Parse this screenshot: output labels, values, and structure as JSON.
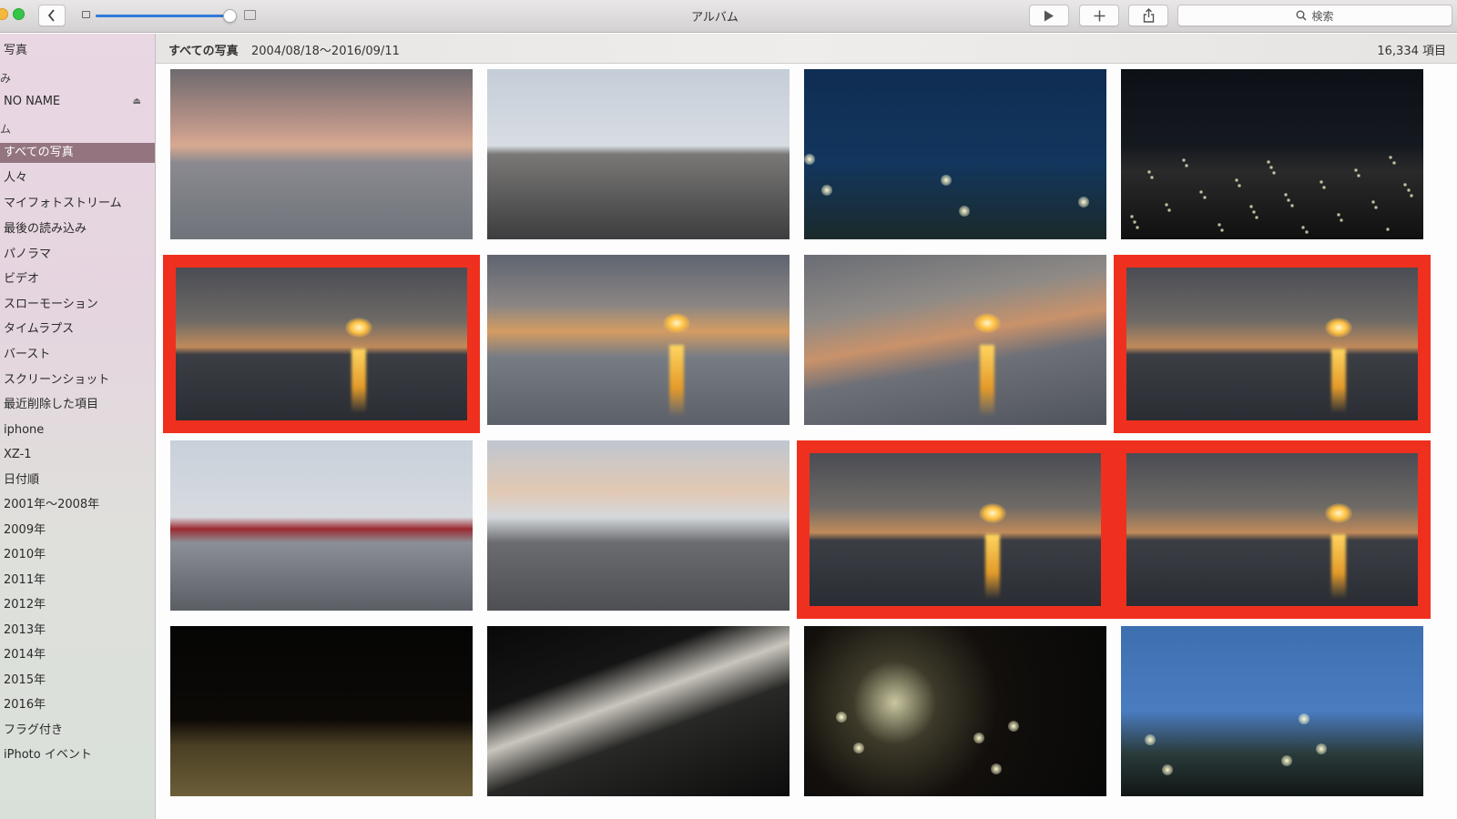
{
  "window": {
    "title": "アルバム"
  },
  "toolbar": {
    "back_icon": "chevron-left-icon",
    "zoom_slider_value": 0.93,
    "play_icon": "play-icon",
    "add_icon": "plus-icon",
    "share_icon": "share-icon",
    "search_placeholder": "検索"
  },
  "sidebar": {
    "items": [
      {
        "label": "写真",
        "type": "header"
      },
      {
        "label": "み",
        "type": "section"
      },
      {
        "label": "NO NAME",
        "type": "device",
        "eject": "⏏"
      },
      {
        "label": "ム",
        "type": "section"
      },
      {
        "label": "すべての写真",
        "type": "album",
        "selected": true
      },
      {
        "label": "人々",
        "type": "album"
      },
      {
        "label": "マイフォトストリーム",
        "type": "album"
      },
      {
        "label": "最後の読み込み",
        "type": "album"
      },
      {
        "label": "パノラマ",
        "type": "album"
      },
      {
        "label": "ビデオ",
        "type": "album"
      },
      {
        "label": "スローモーション",
        "type": "album"
      },
      {
        "label": "タイムラプス",
        "type": "album"
      },
      {
        "label": "バースト",
        "type": "album"
      },
      {
        "label": "スクリーンショット",
        "type": "album"
      },
      {
        "label": "最近削除した項目",
        "type": "album"
      },
      {
        "label": "iphone",
        "type": "album"
      },
      {
        "label": "XZ-1",
        "type": "album"
      },
      {
        "label": "日付順",
        "type": "album"
      },
      {
        "label": "2001年〜2008年",
        "type": "album"
      },
      {
        "label": "2009年",
        "type": "album"
      },
      {
        "label": "2010年",
        "type": "album"
      },
      {
        "label": "2011年",
        "type": "album"
      },
      {
        "label": "2012年",
        "type": "album"
      },
      {
        "label": "2013年",
        "type": "album"
      },
      {
        "label": "2014年",
        "type": "album"
      },
      {
        "label": "2015年",
        "type": "album"
      },
      {
        "label": "2016年",
        "type": "album"
      },
      {
        "label": "フラグ付き",
        "type": "album"
      },
      {
        "label": "iPhoto イベント",
        "type": "album"
      }
    ]
  },
  "header": {
    "breadcrumb": "すべての写真",
    "date_range": "2004/08/18〜2016/09/11",
    "item_count": "16,334 項目"
  },
  "photos": [
    {
      "desc": "sunset over sea with mountain silhouette",
      "style": "dusk-sea",
      "selected": false
    },
    {
      "desc": "pedestrian bridge walkway under cloudy sky",
      "style": "bridge-sky",
      "selected": false
    },
    {
      "desc": "illuminated tower at night with trees",
      "style": "night-tower",
      "selected": false
    },
    {
      "desc": "night city lights panorama",
      "style": "night-city",
      "selected": false
    },
    {
      "desc": "sunset over sea with sun reflection",
      "style": "sunset-sel",
      "selected": true
    },
    {
      "desc": "sunset over sea from bridge railing",
      "style": "sunset-wide",
      "selected": false
    },
    {
      "desc": "tilted sunset over sea",
      "style": "sunset-tilt",
      "selected": false
    },
    {
      "desc": "sunset over sea with sun reflection",
      "style": "sunset-sel",
      "selected": true
    },
    {
      "desc": "red pedestrian bridge over river",
      "style": "red-bridge",
      "selected": false
    },
    {
      "desc": "bridge walkway toward dusk sky",
      "style": "bridge2",
      "selected": false
    },
    {
      "desc": "sunset over sea with sun reflection",
      "style": "sunset-sel",
      "selected": true
    },
    {
      "desc": "sunset over sea with sun reflection",
      "style": "sunset-sel",
      "selected": true
    },
    {
      "desc": "observation deck railing at night",
      "style": "night-rail",
      "selected": false
    },
    {
      "desc": "lit structure at night",
      "style": "night-box",
      "selected": false
    },
    {
      "desc": "trees with lanterns at night",
      "style": "night-trees",
      "selected": false
    },
    {
      "desc": "tower against blue evening sky",
      "style": "blue-tower",
      "selected": false
    }
  ],
  "colors": {
    "selection": "#f0301e",
    "sidebar_selected": "#94757f",
    "slider_accent": "#2f7ad9"
  }
}
